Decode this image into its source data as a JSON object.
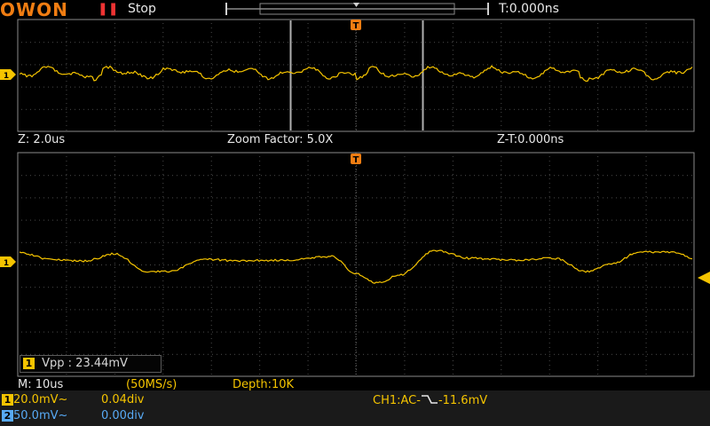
{
  "header": {
    "logo": "OWON",
    "run_state_icon": "pause-bars-icon",
    "status": "Stop",
    "trigger_time": "T:0.000ns"
  },
  "zoom_bar": {
    "zoom_time": "Z: 2.0us",
    "zoom_factor": "Zoom Factor: 5.0X",
    "zoom_trigger_time": "Z-T:0.000ns"
  },
  "markers": {
    "trigger_marker": "T",
    "channel_marker": "1"
  },
  "measurement": {
    "channel": "1",
    "text": "Vpp : 23.44mV"
  },
  "timebase": {
    "main": "M: 10us",
    "sample_rate": "(50MS/s)",
    "depth": "Depth:10K"
  },
  "channels": [
    {
      "id": "1",
      "scale": "20.0mV~",
      "offset": "0.04div",
      "color": "#f5c400"
    },
    {
      "id": "2",
      "scale": "50.0mV~",
      "offset": "0.00div",
      "color": "#58aaf5"
    }
  ],
  "trigger": {
    "source_coupling": "CH1:AC-",
    "edge_icon": "falling-edge-icon",
    "level": "-11.6mV"
  },
  "colors": {
    "brand": "#f07d12",
    "ch1": "#f5c400",
    "ch2": "#58aaf5",
    "grid": "#3c3c3c"
  }
}
